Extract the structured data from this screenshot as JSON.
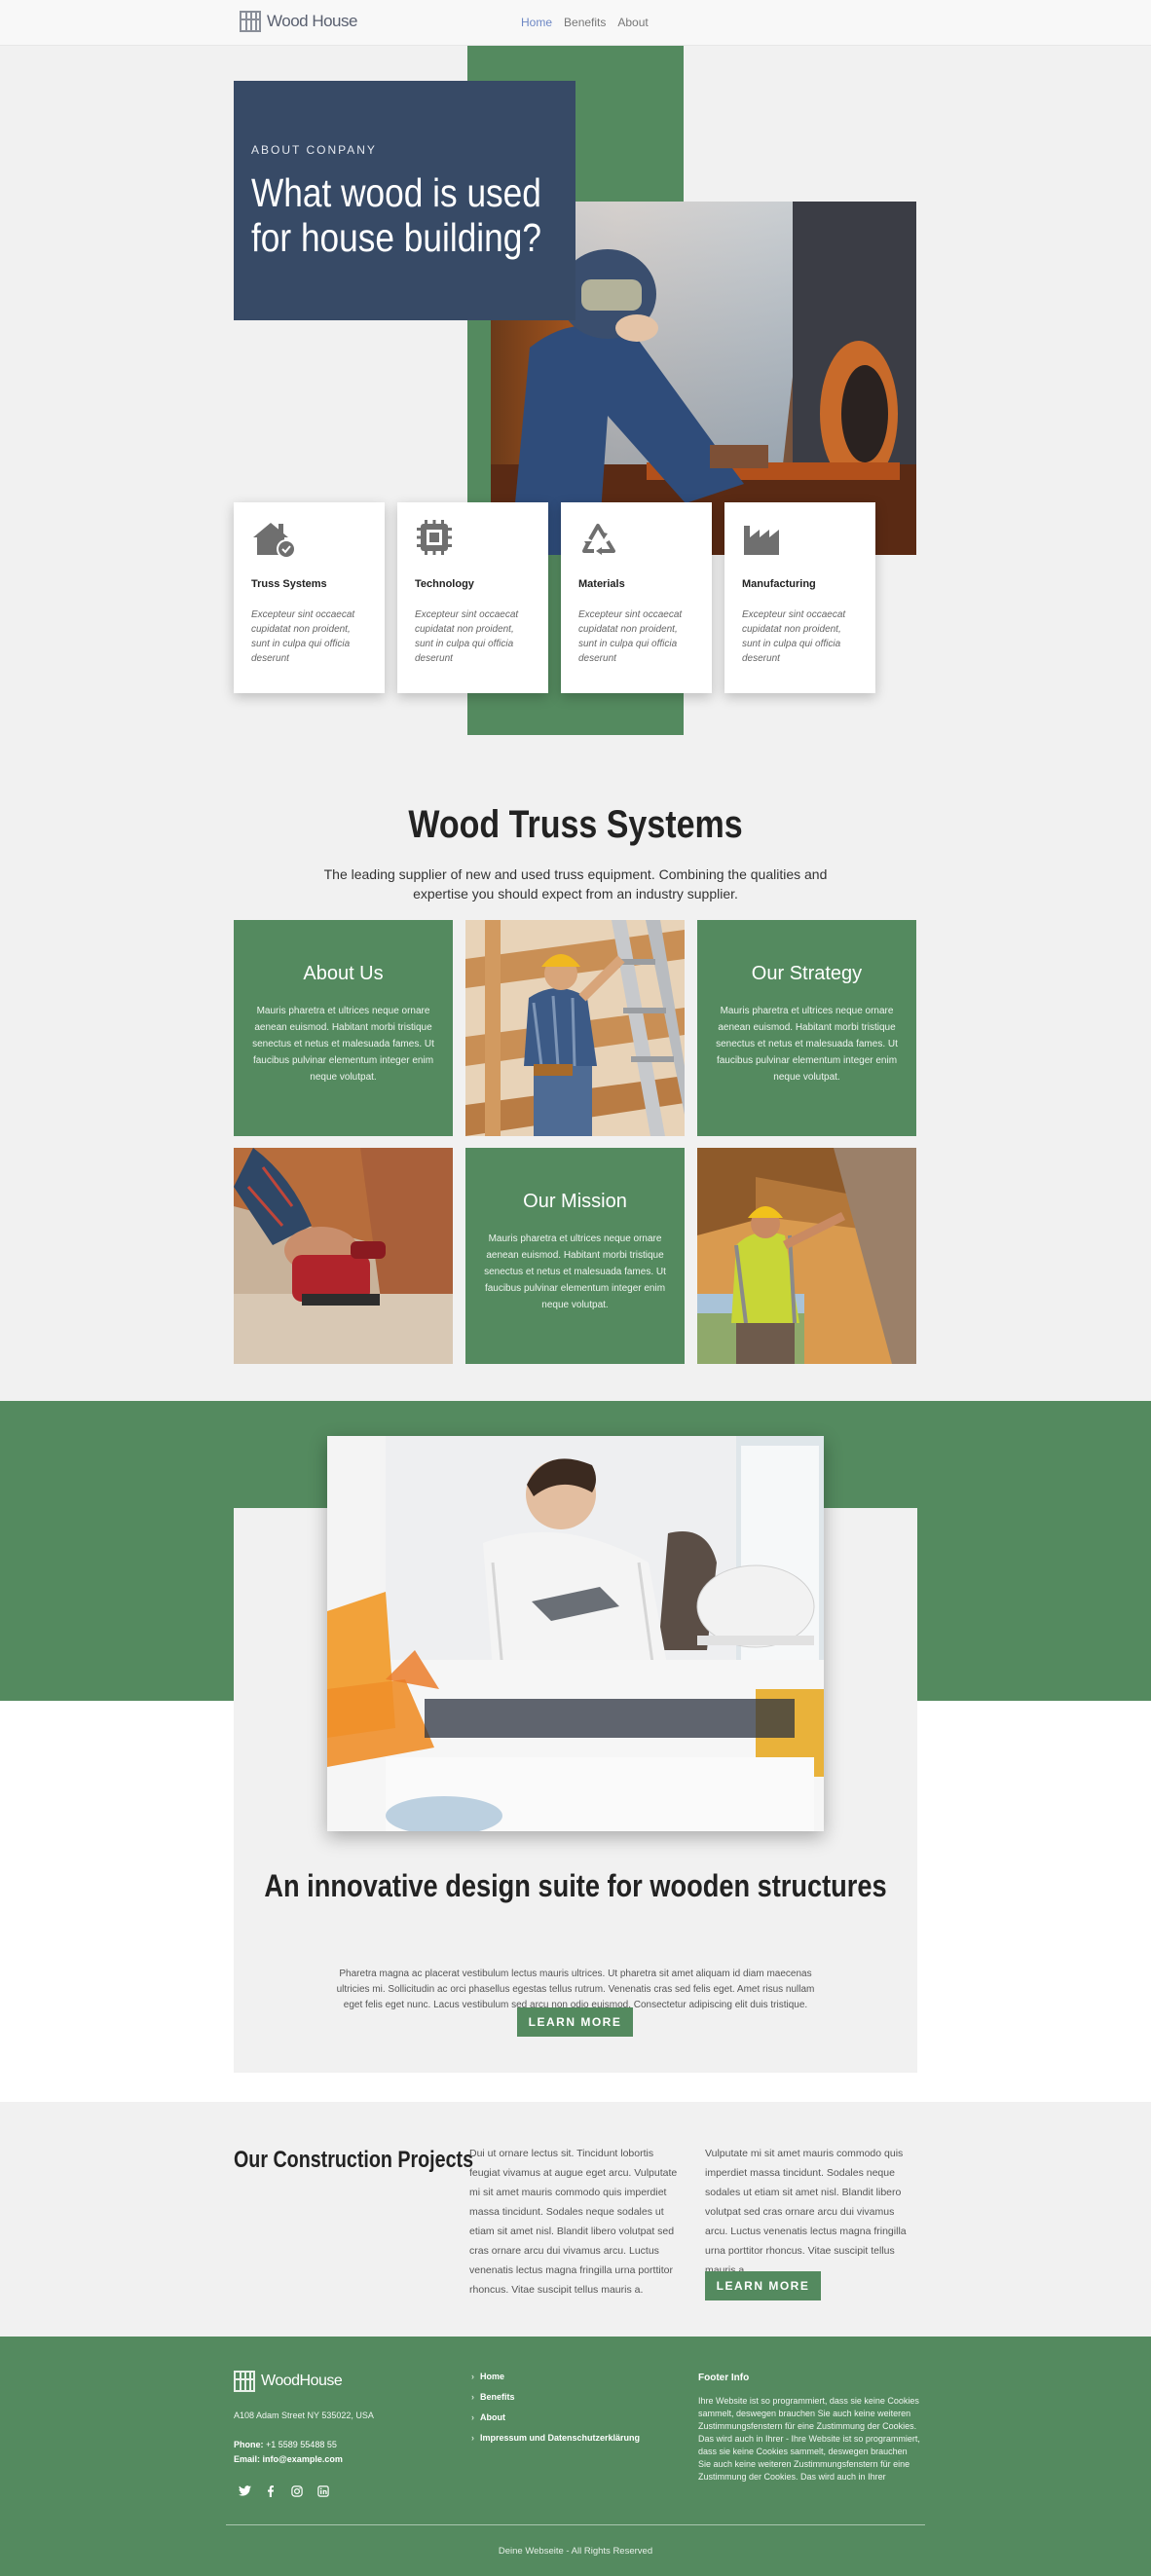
{
  "header": {
    "logo_text": "Wood House",
    "nav": [
      {
        "label": "Home",
        "active": true
      },
      {
        "label": "Benefits",
        "active": false
      },
      {
        "label": "About",
        "active": false
      }
    ]
  },
  "hero": {
    "kicker": "ABOUT CONPANY",
    "title": "What wood is used for house building?",
    "photo_icon": "worker-grinding-photo"
  },
  "features": [
    {
      "icon": "house-check-icon",
      "title": "Truss Systems",
      "text": "Excepteur sint occaecat cupidatat non proident, sunt in culpa qui officia deserunt"
    },
    {
      "icon": "chip-icon",
      "title": "Technology",
      "text": "Excepteur sint occaecat cupidatat non proident, sunt in culpa qui officia deserunt"
    },
    {
      "icon": "recycle-icon",
      "title": "Materials",
      "text": "Excepteur sint occaecat cupidatat non proident, sunt in culpa qui officia deserunt"
    },
    {
      "icon": "factory-icon",
      "title": "Manufacturing",
      "text": "Excepteur sint occaecat cupidatat non proident, sunt in culpa qui officia deserunt"
    }
  ],
  "truss": {
    "title": "Wood Truss Systems",
    "subtitle": "The leading supplier of new and used truss equipment. Combining the qualities and expertise you should expect from an industry supplier.",
    "tiles": [
      {
        "title": "About Us",
        "text": "Mauris pharetra et ultrices neque ornare aenean euismod. Habitant morbi tristique senectus et netus et malesuada fames. Ut faucibus pulvinar elementum integer enim neque volutpat."
      },
      {
        "title": "Our Strategy",
        "text": "Mauris pharetra et ultrices neque ornare aenean euismod. Habitant morbi tristique senectus et netus et malesuada fames. Ut faucibus pulvinar elementum integer enim neque volutpat."
      },
      {
        "title": "Our Mission",
        "text": "Mauris pharetra et ultrices neque ornare aenean euismod. Habitant morbi tristique senectus et netus et malesuada fames. Ut faucibus pulvinar elementum integer enim neque volutpat."
      }
    ]
  },
  "innovation": {
    "title": "An innovative design suite for wooden structures",
    "text": "Pharetra magna ac placerat vestibulum lectus mauris ultrices. Ut pharetra sit amet aliquam id diam maecenas ultricies mi. Sollicitudin ac orci phasellus egestas tellus rutrum. Venenatis cras sed felis eget. Amet risus nullam eget felis eget nunc. Lacus vestibulum sed arcu non odio euismod. Consectetur adipiscing elit duis tristique.",
    "button": "LEARN MORE"
  },
  "projects": {
    "title": "Our Construction Projects",
    "col1": "Dui ut ornare lectus sit. Tincidunt lobortis feugiat vivamus at augue eget arcu. Vulputate mi sit amet mauris commodo quis imperdiet massa tincidunt. Sodales neque sodales ut etiam sit amet nisl. Blandit libero volutpat sed cras ornare arcu dui vivamus arcu. Luctus venenatis lectus magna fringilla urna porttitor rhoncus. Vitae suscipit tellus mauris a.",
    "col2": "Vulputate mi sit amet mauris commodo quis imperdiet massa tincidunt. Sodales neque sodales ut etiam sit amet nisl. Blandit libero volutpat sed cras ornare arcu dui vivamus arcu. Luctus venenatis lectus magna fringilla urna porttitor rhoncus. Vitae suscipit tellus mauris a.",
    "button": "LEARN MORE"
  },
  "footer": {
    "logo_text": "WoodHouse",
    "address": "A108 Adam Street NY 535022, USA",
    "phone_label": "Phone:",
    "phone": "+1 5589 55488 55",
    "email_label": "Email:",
    "email": "info@example.com",
    "social": [
      "twitter-icon",
      "facebook-icon",
      "instagram-icon",
      "linkedin-icon"
    ],
    "links": [
      "Home",
      "Benefits",
      "About",
      "Impressum und Datenschutzerklärung"
    ],
    "info_title": "Footer Info",
    "info_text": "Ihre Website ist so programmiert, dass sie keine Cookies sammelt, deswegen brauchen Sie auch keine weiteren Zustimmungsfenstern für eine Zustimmung der Cookies. Das wird auch in Ihrer - Ihre Website ist so programmiert, dass sie keine Cookies sammelt, deswegen brauchen Sie auch keine weiteren Zustimmungsfenstern für eine Zustimmung der Cookies. Das wird auch in Ihrer",
    "copyright": "Deine Webseite - All Rights Reserved"
  },
  "colors": {
    "green": "#548a5f",
    "navy": "#374a66",
    "accent_nav": "#6d87c4"
  }
}
